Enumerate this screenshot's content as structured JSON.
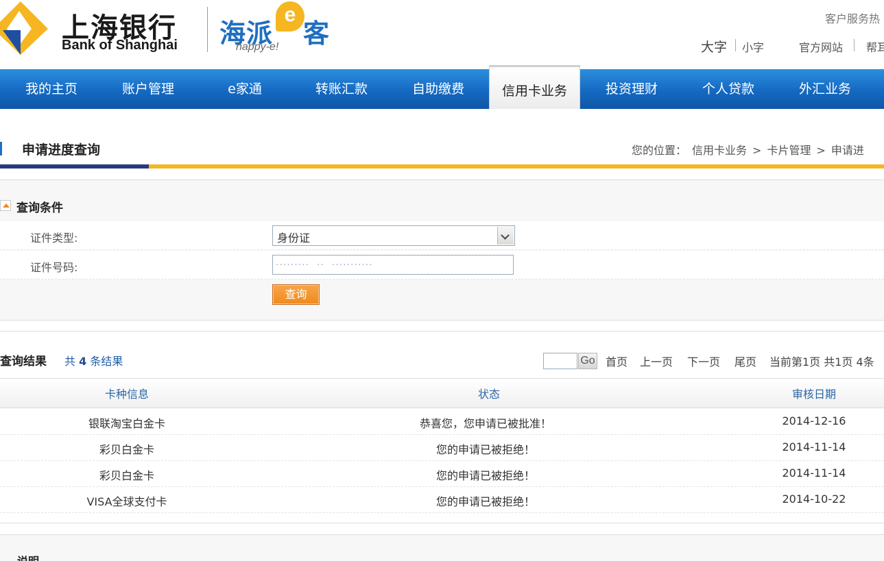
{
  "header": {
    "bank_name_cn": "上海银行",
    "bank_name_en": "Bank of Shanghai",
    "brand_cn": "海派",
    "brand_cn_2": "客",
    "brand_e": "e",
    "brand_en": "happy-e!",
    "hotline_label": "客户服务热",
    "font_big": "大字",
    "font_small": "小字",
    "official_site": "官方网站",
    "help": "帮耳"
  },
  "nav": {
    "items": [
      {
        "label": "我的主页"
      },
      {
        "label": "账户管理"
      },
      {
        "label": "e家通"
      },
      {
        "label": "转账汇款"
      },
      {
        "label": "自助缴费"
      },
      {
        "label": "信用卡业务"
      },
      {
        "label": "投资理财"
      },
      {
        "label": "个人贷款"
      },
      {
        "label": "外汇业务"
      }
    ],
    "active_index": 5
  },
  "page": {
    "title": "申请进度查询",
    "breadcrumb_label": "您的位置：",
    "breadcrumb": [
      "信用卡业务",
      ">",
      "卡片管理",
      ">",
      "申请进"
    ]
  },
  "query": {
    "heading": "查询条件",
    "id_type_label": "证件类型:",
    "id_type_value": "身份证",
    "id_number_label": "证件号码:",
    "id_number_value": "·········  ··  ···········",
    "submit_label": "查询"
  },
  "results": {
    "heading": "查询结果",
    "count_prefix": "共",
    "count": "4",
    "count_suffix": "条结果",
    "pager": {
      "go": "Go",
      "first": "首页",
      "prev": "上一页",
      "next": "下一页",
      "last": "尾页",
      "status": "当前第1页 共1页 4条"
    },
    "columns": [
      "卡种信息",
      "状态",
      "审核日期"
    ],
    "rows": [
      {
        "card": "银联淘宝白金卡",
        "status": "恭喜您，您申请已被批准！",
        "date": "2014-12-16"
      },
      {
        "card": "彩贝白金卡",
        "status": "您的申请已被拒绝！",
        "date": "2014-11-14"
      },
      {
        "card": "彩贝白金卡",
        "status": "您的申请已被拒绝！",
        "date": "2014-11-14"
      },
      {
        "card": "VISA全球支付卡",
        "status": "您的申请已被拒绝！",
        "date": "2014-10-22"
      }
    ]
  },
  "notes": {
    "title": "说明"
  },
  "colors": {
    "nav_blue": "#1569c2",
    "title_blue": "#283a7b",
    "gold": "#f5b622",
    "button_orange": "#f08a1e"
  },
  "icons": {
    "collapse": "collapse-up-icon",
    "select_arrow": "chevron-down-icon"
  }
}
